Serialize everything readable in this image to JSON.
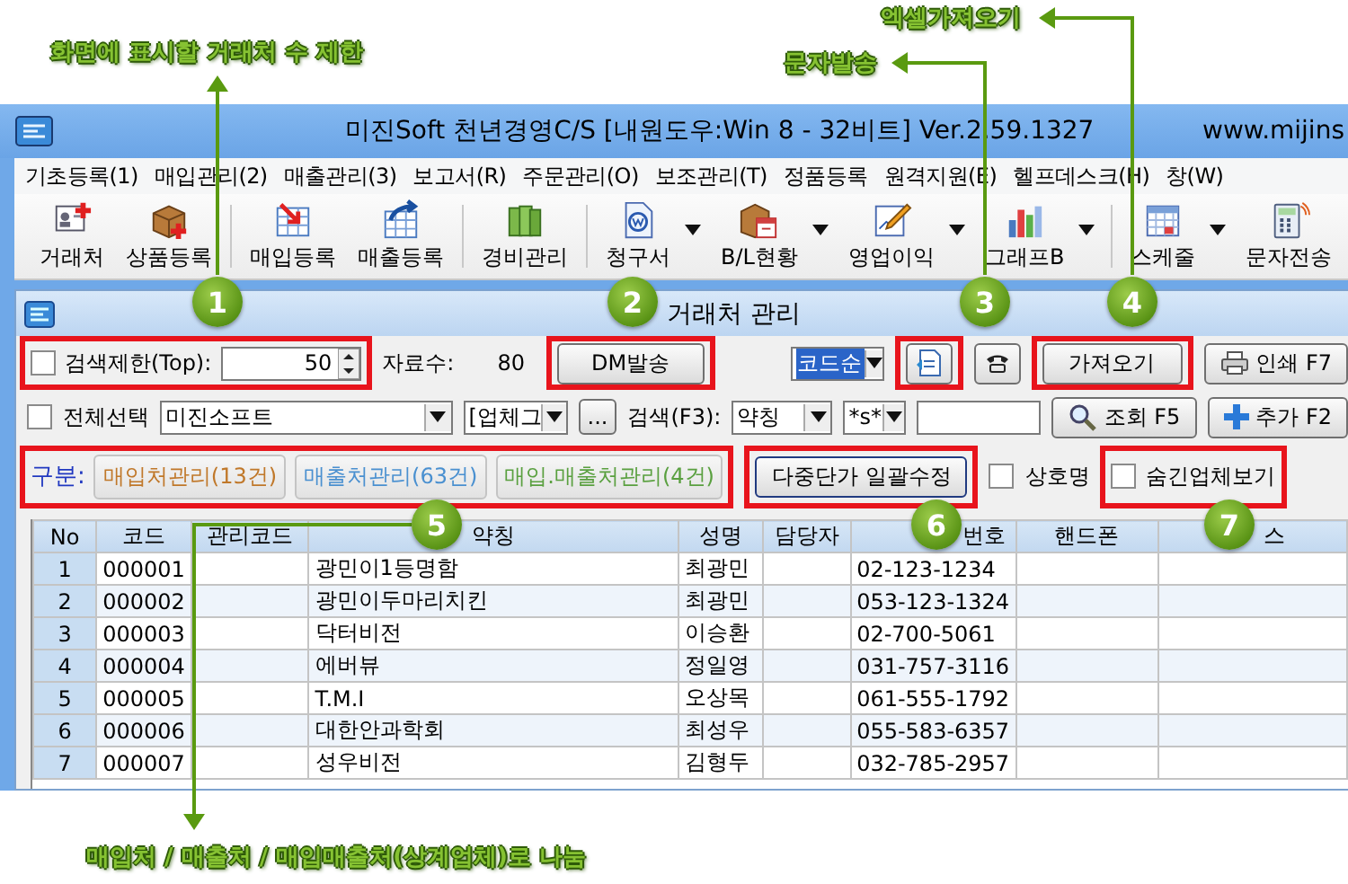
{
  "annotations": [
    {
      "text": "엑셀가져오기"
    },
    {
      "text": "문자발송"
    },
    {
      "text": "화면에 표시할 거래처 수 제한"
    },
    {
      "text": "매입처 / 매출처 / 매입매출처(상계업체)로 나눔"
    }
  ],
  "callouts": [
    "1",
    "2",
    "3",
    "4",
    "5",
    "6",
    "7"
  ],
  "window": {
    "title": "미진Soft 천년경영C/S [내원도우:Win 8 - 32비트] Ver.2.59.1327",
    "url": "www.mijins"
  },
  "menu": [
    "기초등록(1)",
    "매입관리(2)",
    "매출관리(3)",
    "보고서(R)",
    "주문관리(O)",
    "보조관리(T)",
    "정품등록",
    "원격지원(E)",
    "헬프데스크(H)",
    "창(W)"
  ],
  "toolbar": [
    {
      "label": "거래처",
      "dropdown": false
    },
    {
      "label": "상품등록",
      "dropdown": false
    },
    {
      "label": "매입등록",
      "dropdown": false
    },
    {
      "label": "매출등록",
      "dropdown": false
    },
    {
      "label": "경비관리",
      "dropdown": false
    },
    {
      "label": "청구서",
      "dropdown": true
    },
    {
      "label": "B/L현황",
      "dropdown": true
    },
    {
      "label": "영업이익",
      "dropdown": true
    },
    {
      "label": "그래프B",
      "dropdown": true
    },
    {
      "label": "스케줄",
      "dropdown": true
    },
    {
      "label": "문자전송",
      "dropdown": false
    }
  ],
  "dialog": {
    "title": "거래처 관리",
    "search_limit": {
      "label": "검색제한(Top):",
      "checked": false,
      "value": "50"
    },
    "record_count": {
      "label": "자료수:",
      "value": "80"
    },
    "dm_button": "DM발송",
    "sort": "코드순",
    "import_button": "가져오기",
    "print_button": "인쇄 F7",
    "select_all": {
      "label": "전체선택",
      "checked": false
    },
    "company": "미진소프트",
    "category": "[업체그",
    "more_button": "...",
    "search": {
      "label": "검색(F3):",
      "field": "약칭",
      "match": "*s*"
    },
    "query_button": "조회 F5",
    "add_button": "추가 F2",
    "tabs": {
      "label": "구분:",
      "items": [
        {
          "label": "매입처관리(13건)",
          "color": "#c0782a"
        },
        {
          "label": "매출처관리(63건)",
          "color": "#4a90d0"
        },
        {
          "label": "매입.매출처관리(4건)",
          "color": "#5aa040"
        }
      ]
    },
    "bulk_button": "다중단가 일괄수정",
    "name_check": {
      "label": "상호명",
      "checked": false
    },
    "hidden_check": {
      "label": "숨긴업체보기",
      "checked": false
    }
  },
  "table": {
    "columns": [
      "No",
      "코드",
      "관리코드",
      "약칭",
      "성명",
      "담당자",
      "번호",
      "핸드폰",
      "스"
    ],
    "rows": [
      {
        "no": "1",
        "code": "000001",
        "name": "광민이1등명함",
        "contact": "최광민",
        "phone": "02-123-1234"
      },
      {
        "no": "2",
        "code": "000002",
        "name": "광민이두마리치킨",
        "contact": "최광민",
        "phone": "053-123-1324"
      },
      {
        "no": "3",
        "code": "000003",
        "name": "닥터비전",
        "contact": "이승환",
        "phone": "02-700-5061"
      },
      {
        "no": "4",
        "code": "000004",
        "name": "에버뷰",
        "contact": "정일영",
        "phone": "031-757-3116"
      },
      {
        "no": "5",
        "code": "000005",
        "name": "T.M.I",
        "contact": "오상목",
        "phone": "061-555-1792"
      },
      {
        "no": "6",
        "code": "000006",
        "name": "대한안과학회",
        "contact": "최성우",
        "phone": "055-583-6357"
      },
      {
        "no": "7",
        "code": "000007",
        "name": "성우비전",
        "contact": "김형두",
        "phone": "032-785-2957"
      }
    ]
  }
}
